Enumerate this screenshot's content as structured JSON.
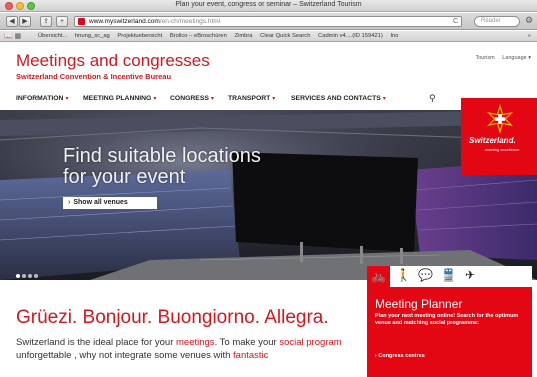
{
  "window": {
    "title": "Plan your event, congress or seminar – Switzerland Tourism"
  },
  "toolbar": {
    "back": "◀",
    "forward": "▶",
    "share": "⇪",
    "add": "+",
    "url_host": "www.myswitzerland.com",
    "url_path": "/en-ch/meetings.html",
    "reload": "C",
    "search_placeholder": "Reader",
    "gear": "⚙"
  },
  "bookmarks": {
    "icons": "📖 ▦",
    "items": [
      "Übersicht...",
      "hnung_sc_ag",
      "Projektuebersicht",
      "Brolico – eBroschüren",
      "Zimbra",
      "Clear Quick Search",
      "Cadmin v4....(ID 159421)",
      "Ino"
    ],
    "more": "»"
  },
  "header": {
    "title": "Meetings and congresses",
    "subtitle": "Switzerland Convention & Incentive Bureau",
    "links": [
      "Tourism",
      "Language ▾"
    ]
  },
  "nav": {
    "items": [
      {
        "label": "INFORMATION"
      },
      {
        "label": "MEETING PLANNING"
      },
      {
        "label": "CONGRESS"
      },
      {
        "label": "TRANSPORT"
      },
      {
        "label": "SERVICES AND CONTACTS"
      }
    ],
    "chevron": "▾",
    "search_icon": "⚲"
  },
  "brand": {
    "name": "Switzerland.",
    "tagline": "meeting excellence.",
    "color": "#e30613"
  },
  "hero": {
    "title_line1": "Find suitable locations",
    "title_line2": "for your event",
    "button_label": "Show all venues",
    "chevron": "›",
    "slides": 4,
    "active_slide": 0
  },
  "planner": {
    "icons": [
      "🚲",
      "🚶",
      "💬",
      "🚆",
      "✈"
    ],
    "title": "Meeting Planner",
    "text": "Plan your next meeting online! Search for the optimum venue and matching social programme:",
    "link": "› Congress centres"
  },
  "welcome": {
    "greeting": "Grüezi. Bonjour. Buongiorno. Allegra.",
    "intro_1": "Switzerland is the ideal place for your ",
    "intro_link1": "meetings",
    "intro_2": ". To make your ",
    "intro_link2": "social program",
    "intro_3": " unforgettable , why not integrate some venues with ",
    "intro_link3": "fantastic"
  }
}
